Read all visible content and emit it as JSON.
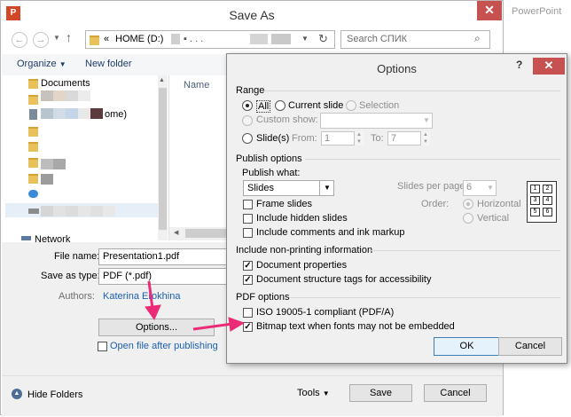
{
  "app": {
    "name": "PowerPoint",
    "icon_letter": "P"
  },
  "save_as": {
    "title": "Save As",
    "address": {
      "chevron": "«",
      "drive": "HOME (D:)",
      "dots": "▪  .  .  ."
    },
    "search_placeholder": "Search СПИК",
    "toolbar": {
      "organize": "Organize",
      "new_folder": "New folder"
    },
    "nav_items": [
      {
        "label": "Documents"
      },
      {
        "label": "ome)"
      }
    ],
    "network_label": "Network",
    "column_name": "Name",
    "file_name_label": "File name:",
    "file_name_value": "Presentation1.pdf",
    "save_type_label": "Save as type:",
    "save_type_value": "PDF (*.pdf)",
    "authors_label": "Authors:",
    "authors_value": "Katerina Erokhina",
    "options_button": "Options...",
    "open_after_label": "Open file after publishing",
    "hide_folders": "Hide Folders",
    "tools": "Tools",
    "save": "Save",
    "cancel": "Cancel"
  },
  "options": {
    "title": "Options",
    "help": "?",
    "close": "✕",
    "range": {
      "heading": "Range",
      "all": "All",
      "current_slide": "Current slide",
      "selection": "Selection",
      "custom_show": "Custom show:",
      "slides": "Slide(s)",
      "from_label": "From:",
      "from_value": "1",
      "to_label": "To:",
      "to_value": "7",
      "selected": "All"
    },
    "publish": {
      "heading": "Publish options",
      "publish_what_label": "Publish what:",
      "publish_what_value": "Slides",
      "slides_per_page_label": "Slides per page:",
      "slides_per_page_value": "6",
      "order_label": "Order:",
      "horizontal": "Horizontal",
      "vertical": "Vertical",
      "frame_slides": "Frame slides",
      "include_hidden": "Include hidden slides",
      "include_comments": "Include comments and ink markup",
      "thumb_numbers": [
        "1",
        "2",
        "3",
        "4",
        "5",
        "6"
      ]
    },
    "nonprinting": {
      "heading": "Include non-printing information",
      "doc_properties": "Document properties",
      "doc_structure": "Document structure tags for accessibility"
    },
    "pdf": {
      "heading": "PDF options",
      "iso": "ISO 19005-1 compliant (PDF/A)",
      "bitmap": "Bitmap text when fonts may not be embedded"
    },
    "ok": "OK",
    "cancel": "Cancel"
  },
  "colors": {
    "arrow": "#ec2b76",
    "close_red": "#c75050",
    "link_blue": "#1a5fb4"
  }
}
